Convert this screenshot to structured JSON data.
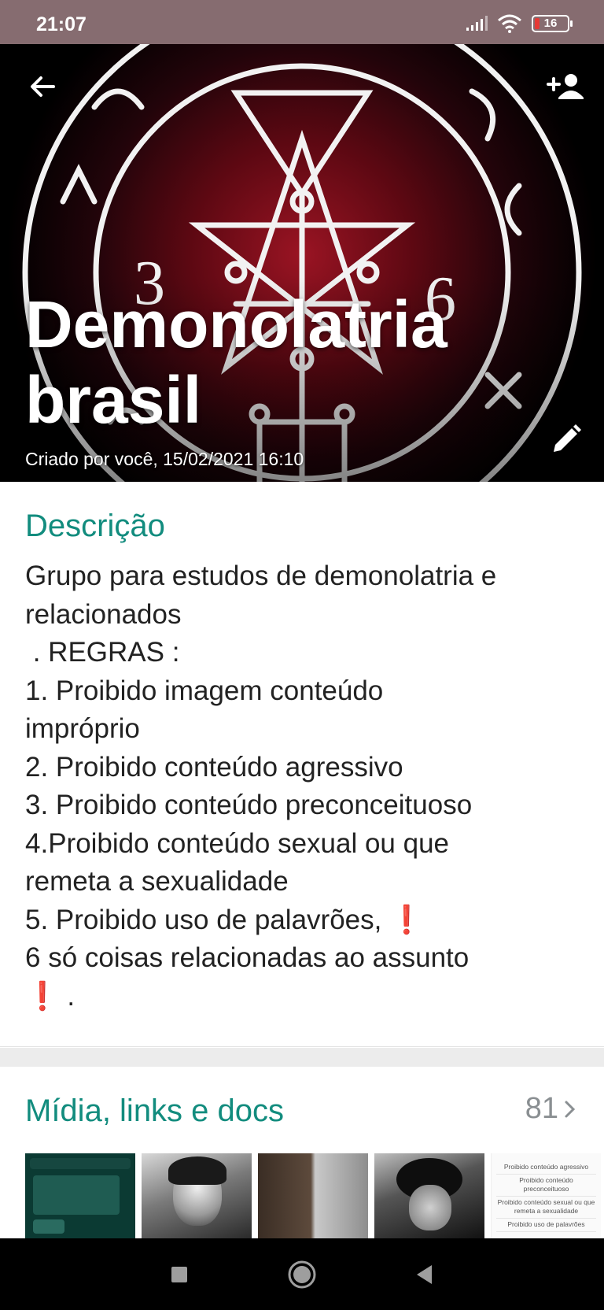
{
  "status_bar": {
    "time": "21:07",
    "battery": "16",
    "icons": [
      "signal-icon",
      "wifi-icon",
      "battery-icon"
    ]
  },
  "header": {
    "title_line1": "Demonolatria",
    "title_line2": "brasil",
    "created": "Criado por você, 15/02/2021 16:10",
    "icons": [
      "back-arrow-icon",
      "add-participant-icon",
      "edit-pencil-icon"
    ]
  },
  "description": {
    "heading": "Descrição",
    "lines": [
      "Grupo para estudos de demonolatria e",
      "relacionados",
      " . REGRAS :",
      "1. Proibido imagem conteúdo",
      "impróprio",
      "2. Proibido conteúdo agressivo",
      "3. Proibido conteúdo preconceituoso",
      "4.Proibido conteúdo sexual ou que",
      "remeta a sexualidade",
      "5. Proibido uso de palavrões, ",
      "6 só coisas relacionadas ao assunto",
      " ."
    ],
    "exclamation": "❗"
  },
  "media": {
    "heading": "Mídia, links e docs",
    "count": "81",
    "doc_thumb_lines": [
      "Proibido conteúdo agressivo",
      "Proibido conteúdo preconceituoso",
      "Proibido conteúdo sexual ou que remeta a sexualidade",
      "Proibido uso de palavrões"
    ]
  },
  "nav": {
    "icons": [
      "recents-square-icon",
      "home-circle-icon",
      "back-triangle-icon"
    ]
  },
  "colors": {
    "accent": "#128c7e",
    "status_bar": "#866c70",
    "alert": "#e0201b"
  }
}
